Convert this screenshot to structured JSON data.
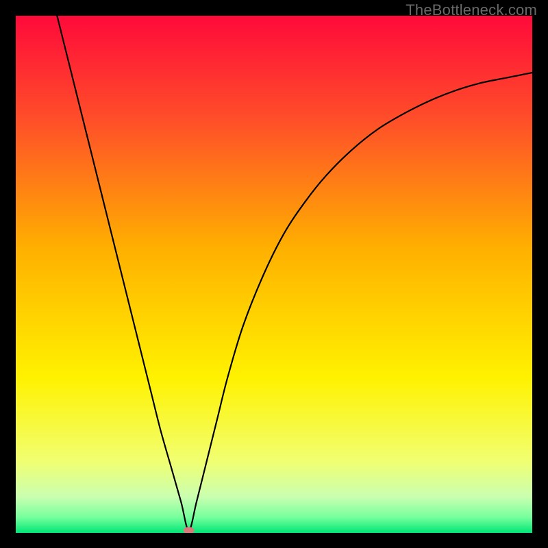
{
  "watermark": "TheBottleneck.com",
  "chart_data": {
    "type": "line",
    "title": "",
    "xlabel": "",
    "ylabel": "",
    "xlim": [
      0,
      100
    ],
    "ylim": [
      0,
      100
    ],
    "grid": false,
    "legend": false,
    "background_gradient": {
      "stops": [
        {
          "offset": 0.0,
          "color": "#ff0a3a"
        },
        {
          "offset": 0.2,
          "color": "#ff4e29"
        },
        {
          "offset": 0.45,
          "color": "#ffb000"
        },
        {
          "offset": 0.7,
          "color": "#fff200"
        },
        {
          "offset": 0.86,
          "color": "#f1ff70"
        },
        {
          "offset": 0.93,
          "color": "#caffb0"
        },
        {
          "offset": 0.97,
          "color": "#76ff9d"
        },
        {
          "offset": 1.0,
          "color": "#00e676"
        }
      ]
    },
    "min_marker": {
      "x": 33.5,
      "y": 0.5,
      "color": "#d97b7b"
    },
    "series": [
      {
        "name": "curve",
        "color": "#000000",
        "x": [
          8,
          10,
          12,
          14,
          16,
          18,
          20,
          22,
          24,
          26,
          28,
          30,
          32,
          33.5,
          35,
          37,
          39,
          41,
          44,
          48,
          52,
          56,
          60,
          65,
          70,
          75,
          80,
          85,
          90,
          95,
          100
        ],
        "y": [
          100,
          92,
          84,
          76,
          68,
          60,
          52,
          44,
          36,
          28,
          20,
          13,
          6,
          0.5,
          6,
          14,
          22,
          30,
          40,
          50,
          58,
          64,
          69,
          74,
          78,
          81,
          83.5,
          85.5,
          87,
          88,
          89
        ]
      }
    ]
  }
}
